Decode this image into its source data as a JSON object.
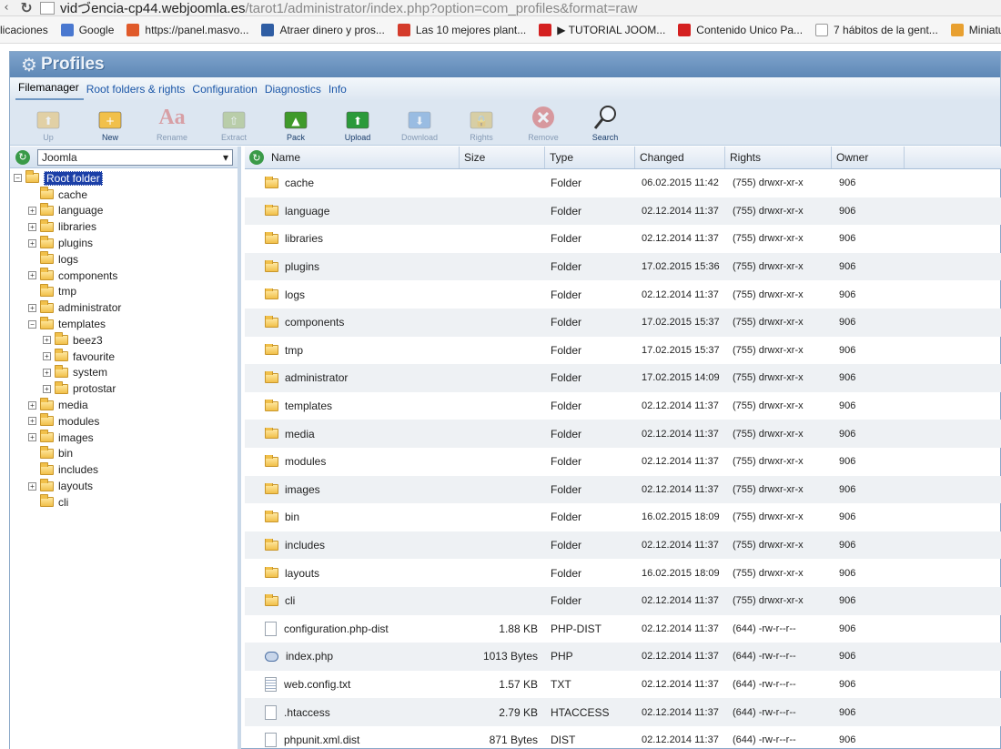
{
  "browser": {
    "url_domain": "vidづencia-cp44.webjoomla.es",
    "url_path": "/tarot1/administrator/index.php?option=com_profiles&format=raw"
  },
  "bookmarks": [
    {
      "label": "licaciones",
      "color": "#f6f6f6"
    },
    {
      "label": "Google",
      "color": "#4a78d0"
    },
    {
      "label": "https://panel.masvo...",
      "color": "#e05a2a"
    },
    {
      "label": "Atraer dinero y pros...",
      "color": "#2f5da3"
    },
    {
      "label": "Las 10 mejores plant...",
      "color": "#d43b2b"
    },
    {
      "label": "▶ TUTORIAL JOOM...",
      "color": "#d42020"
    },
    {
      "label": "Contenido Unico Pa...",
      "color": "#d42020"
    },
    {
      "label": "7 hábitos de la gent...",
      "color": "#ffffff"
    },
    {
      "label": "Miniaturas",
      "color": "#e8a030"
    }
  ],
  "app": {
    "title": "Profiles",
    "menu": [
      "Filemanager",
      "Root folders & rights",
      "Configuration",
      "Diagnostics",
      "Info"
    ],
    "toolbar": [
      {
        "label": "Up",
        "icon": "up-icon",
        "enabled": false,
        "color": "#e9b64a"
      },
      {
        "label": "New",
        "icon": "new-folder-icon",
        "enabled": true,
        "color": "#f1c04a"
      },
      {
        "label": "Rename",
        "icon": "rename-icon",
        "enabled": false,
        "color": "#d24a4a"
      },
      {
        "label": "Extract",
        "icon": "extract-icon",
        "enabled": false,
        "color": "#8fb054"
      },
      {
        "label": "Pack",
        "icon": "pack-icon",
        "enabled": true,
        "color": "#3f9a2a"
      },
      {
        "label": "Upload",
        "icon": "upload-icon",
        "enabled": true,
        "color": "#2b9a3a"
      },
      {
        "label": "Download",
        "icon": "download-icon",
        "enabled": false,
        "color": "#4a8bd0"
      },
      {
        "label": "Rights",
        "icon": "rights-icon",
        "enabled": false,
        "color": "#d2b24a"
      },
      {
        "label": "Remove",
        "icon": "remove-icon",
        "enabled": false,
        "color": "#d23a3a"
      },
      {
        "label": "Search",
        "icon": "search-icon",
        "enabled": true,
        "color": "#333333"
      }
    ]
  },
  "tree": {
    "root_select": "Joomla",
    "nodes": [
      {
        "label": "Root folder",
        "level": 0,
        "exp": "minus",
        "selected": true
      },
      {
        "label": "cache",
        "level": 1,
        "exp": "none"
      },
      {
        "label": "language",
        "level": 1,
        "exp": "plus"
      },
      {
        "label": "libraries",
        "level": 1,
        "exp": "plus"
      },
      {
        "label": "plugins",
        "level": 1,
        "exp": "plus"
      },
      {
        "label": "logs",
        "level": 1,
        "exp": "none"
      },
      {
        "label": "components",
        "level": 1,
        "exp": "plus"
      },
      {
        "label": "tmp",
        "level": 1,
        "exp": "none"
      },
      {
        "label": "administrator",
        "level": 1,
        "exp": "plus"
      },
      {
        "label": "templates",
        "level": 1,
        "exp": "minus"
      },
      {
        "label": "beez3",
        "level": 2,
        "exp": "plus"
      },
      {
        "label": "favourite",
        "level": 2,
        "exp": "plus"
      },
      {
        "label": "system",
        "level": 2,
        "exp": "plus"
      },
      {
        "label": "protostar",
        "level": 2,
        "exp": "plus"
      },
      {
        "label": "media",
        "level": 1,
        "exp": "plus"
      },
      {
        "label": "modules",
        "level": 1,
        "exp": "plus"
      },
      {
        "label": "images",
        "level": 1,
        "exp": "plus"
      },
      {
        "label": "bin",
        "level": 1,
        "exp": "none"
      },
      {
        "label": "includes",
        "level": 1,
        "exp": "none"
      },
      {
        "label": "layouts",
        "level": 1,
        "exp": "plus"
      },
      {
        "label": "cli",
        "level": 1,
        "exp": "none"
      }
    ]
  },
  "grid": {
    "columns": [
      "Name",
      "Size",
      "Type",
      "Changed",
      "Rights",
      "Owner"
    ],
    "rows": [
      {
        "name": "cache",
        "size": "",
        "type": "Folder",
        "changed": "06.02.2015 11:42",
        "rights": "(755) drwxr-xr-x",
        "owner": "906",
        "kind": "folder"
      },
      {
        "name": "language",
        "size": "",
        "type": "Folder",
        "changed": "02.12.2014 11:37",
        "rights": "(755) drwxr-xr-x",
        "owner": "906",
        "kind": "folder"
      },
      {
        "name": "libraries",
        "size": "",
        "type": "Folder",
        "changed": "02.12.2014 11:37",
        "rights": "(755) drwxr-xr-x",
        "owner": "906",
        "kind": "folder"
      },
      {
        "name": "plugins",
        "size": "",
        "type": "Folder",
        "changed": "17.02.2015 15:36",
        "rights": "(755) drwxr-xr-x",
        "owner": "906",
        "kind": "folder"
      },
      {
        "name": "logs",
        "size": "",
        "type": "Folder",
        "changed": "02.12.2014 11:37",
        "rights": "(755) drwxr-xr-x",
        "owner": "906",
        "kind": "folder"
      },
      {
        "name": "components",
        "size": "",
        "type": "Folder",
        "changed": "17.02.2015 15:37",
        "rights": "(755) drwxr-xr-x",
        "owner": "906",
        "kind": "folder"
      },
      {
        "name": "tmp",
        "size": "",
        "type": "Folder",
        "changed": "17.02.2015 15:37",
        "rights": "(755) drwxr-xr-x",
        "owner": "906",
        "kind": "folder"
      },
      {
        "name": "administrator",
        "size": "",
        "type": "Folder",
        "changed": "17.02.2015 14:09",
        "rights": "(755) drwxr-xr-x",
        "owner": "906",
        "kind": "folder"
      },
      {
        "name": "templates",
        "size": "",
        "type": "Folder",
        "changed": "02.12.2014 11:37",
        "rights": "(755) drwxr-xr-x",
        "owner": "906",
        "kind": "folder"
      },
      {
        "name": "media",
        "size": "",
        "type": "Folder",
        "changed": "02.12.2014 11:37",
        "rights": "(755) drwxr-xr-x",
        "owner": "906",
        "kind": "folder"
      },
      {
        "name": "modules",
        "size": "",
        "type": "Folder",
        "changed": "02.12.2014 11:37",
        "rights": "(755) drwxr-xr-x",
        "owner": "906",
        "kind": "folder"
      },
      {
        "name": "images",
        "size": "",
        "type": "Folder",
        "changed": "02.12.2014 11:37",
        "rights": "(755) drwxr-xr-x",
        "owner": "906",
        "kind": "folder"
      },
      {
        "name": "bin",
        "size": "",
        "type": "Folder",
        "changed": "16.02.2015 18:09",
        "rights": "(755) drwxr-xr-x",
        "owner": "906",
        "kind": "folder"
      },
      {
        "name": "includes",
        "size": "",
        "type": "Folder",
        "changed": "02.12.2014 11:37",
        "rights": "(755) drwxr-xr-x",
        "owner": "906",
        "kind": "folder"
      },
      {
        "name": "layouts",
        "size": "",
        "type": "Folder",
        "changed": "16.02.2015 18:09",
        "rights": "(755) drwxr-xr-x",
        "owner": "906",
        "kind": "folder"
      },
      {
        "name": "cli",
        "size": "",
        "type": "Folder",
        "changed": "02.12.2014 11:37",
        "rights": "(755) drwxr-xr-x",
        "owner": "906",
        "kind": "folder"
      },
      {
        "name": "configuration.php-dist",
        "size": "1.88 KB",
        "type": "PHP-DIST",
        "changed": "02.12.2014 11:37",
        "rights": "(644) -rw-r--r--",
        "owner": "906",
        "kind": "file"
      },
      {
        "name": "index.php",
        "size": "1013 Bytes",
        "type": "PHP",
        "changed": "02.12.2014 11:37",
        "rights": "(644) -rw-r--r--",
        "owner": "906",
        "kind": "php"
      },
      {
        "name": "web.config.txt",
        "size": "1.57 KB",
        "type": "TXT",
        "changed": "02.12.2014 11:37",
        "rights": "(644) -rw-r--r--",
        "owner": "906",
        "kind": "txt"
      },
      {
        "name": ".htaccess",
        "size": "2.79 KB",
        "type": "HTACCESS",
        "changed": "02.12.2014 11:37",
        "rights": "(644) -rw-r--r--",
        "owner": "906",
        "kind": "file"
      },
      {
        "name": "phpunit.xml.dist",
        "size": "871 Bytes",
        "type": "DIST",
        "changed": "02.12.2014 11:37",
        "rights": "(644) -rw-r--r--",
        "owner": "906",
        "kind": "file"
      }
    ]
  }
}
